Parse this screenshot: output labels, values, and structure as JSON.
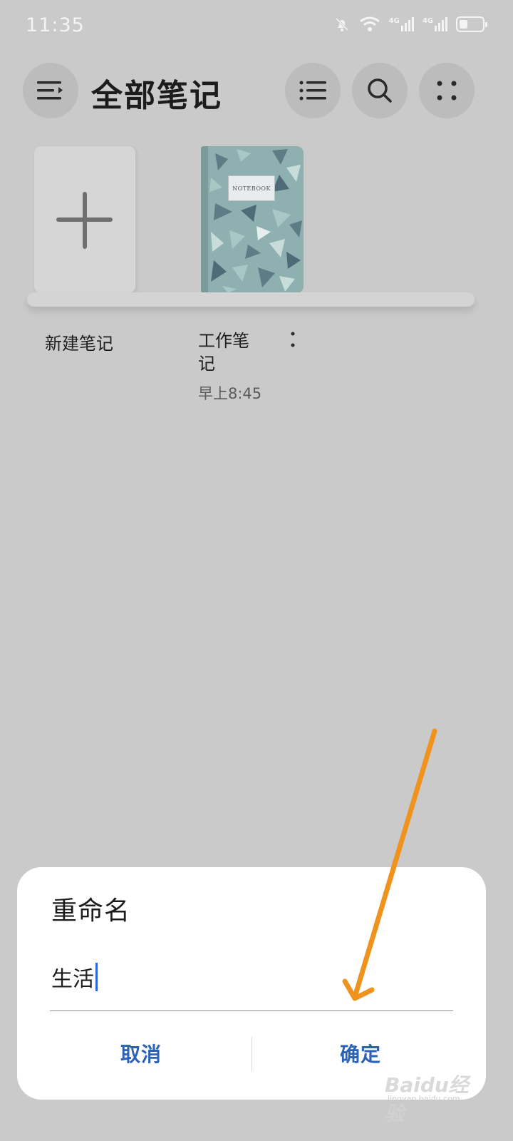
{
  "status_bar": {
    "time": "11:35",
    "network_1": "4G",
    "network_2": "4G",
    "battery_level": 0.35
  },
  "header": {
    "title": "全部笔记",
    "menu_icon": "menu-expand-icon",
    "list_icon": "list-view-icon",
    "search_icon": "search-icon",
    "more_icon": "more-grid-icon"
  },
  "notes": {
    "new_note_label": "新建笔记",
    "items": [
      {
        "label": "工作笔\n记",
        "time": "早上8:45",
        "cover_text": "NOTEBOOK"
      }
    ]
  },
  "rename_dialog": {
    "title": "重命名",
    "input_value": "生活",
    "cancel_label": "取消",
    "confirm_label": "确定",
    "accent_color": "#2b62b5"
  },
  "annotation": {
    "arrow_color": "#f0931e"
  },
  "watermark": {
    "text": "Baidu经验",
    "sub": "jingyan.baidu.com"
  }
}
